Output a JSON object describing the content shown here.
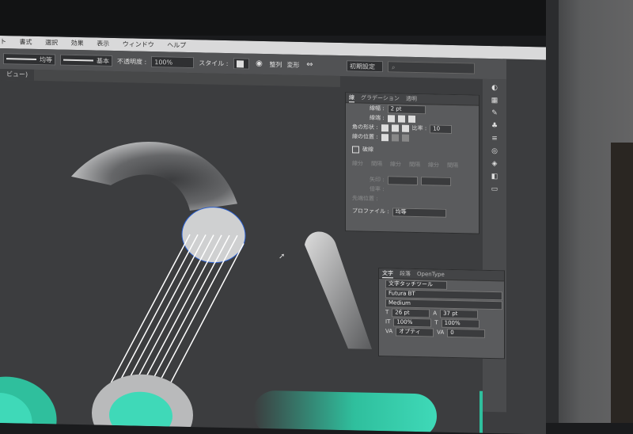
{
  "menubar": {
    "items": [
      "ト",
      "書式",
      "選択",
      "効果",
      "表示",
      "ウィンドウ",
      "ヘルプ"
    ]
  },
  "control": {
    "stroke1_label": "均等",
    "stroke2_label": "基本",
    "opacity_label": "不透明度 :",
    "opacity_value": "100%",
    "style_label": "スタイル :",
    "align_label": "整列",
    "transform_label": "変形",
    "preset_label": "初期設定",
    "search_placeholder": "",
    "doc_tab": "ビュー)"
  },
  "stroke_panel": {
    "tabs": [
      "線",
      "グラデーション",
      "透明"
    ],
    "weight_label": "線幅 :",
    "weight_value": "2 pt",
    "cap_label": "線端 :",
    "corner_label": "角の形状 :",
    "limit_label": "比率 :",
    "limit_value": "10",
    "align_label": "線の位置 :",
    "dashed_label": "破線",
    "dash_cols": [
      "線分",
      "間隔",
      "線分",
      "間隔",
      "線分",
      "間隔"
    ],
    "arrow_label": "矢印 :",
    "scale_label": "倍率 :",
    "align_arrow_label": "先端位置 :",
    "profile_label": "プロファイル :",
    "profile_value": "均等"
  },
  "char_panel": {
    "tabs": [
      "文字",
      "段落",
      "OpenType"
    ],
    "tool_label": "文字タッチツール",
    "font_family": "Futura BT",
    "font_style": "Medium",
    "size_value": "26 pt",
    "leading_value": "37 pt",
    "vscale_value": "100%",
    "hscale_value": "100%",
    "kerning_value": "オプティ",
    "tracking_value": "0"
  },
  "colors": {
    "accent": "#3fd9b8",
    "screen_bg": "#3c3d3f",
    "panel": "#5a5b5d"
  }
}
